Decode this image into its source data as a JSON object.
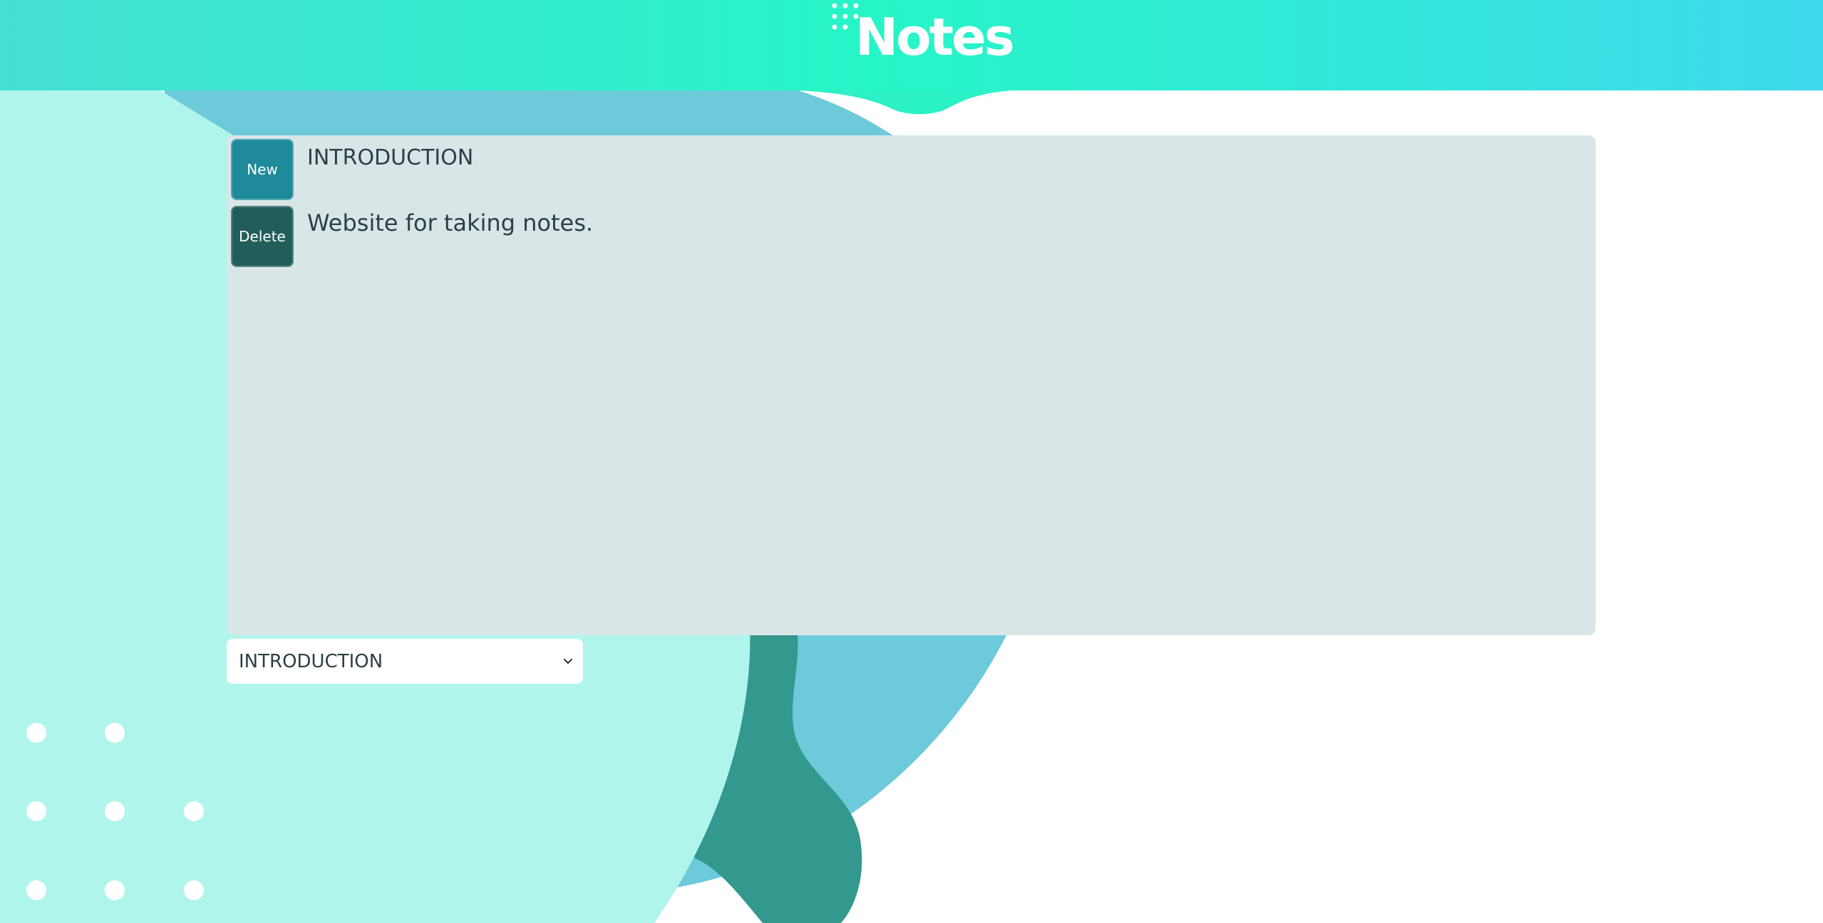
{
  "app": {
    "title": "Notes"
  },
  "colors": {
    "header_gradient": [
      "#45dfd4",
      "#26f5c7",
      "#3ed9ec"
    ],
    "panel_background": "#d9e6e8",
    "new_button": "#1e8a9a",
    "delete_button": "#215e5a",
    "text": "#2e3f45",
    "blob_mint": "#b0f5eb",
    "blob_blue": "#6ccadb",
    "blob_teal": "#33988e"
  },
  "toolbar": {
    "new_label": "New",
    "delete_label": "Delete"
  },
  "note": {
    "title": "INTRODUCTION",
    "body": "Website for taking notes."
  },
  "note_selector": {
    "selected": "INTRODUCTION",
    "options": [
      "INTRODUCTION"
    ]
  },
  "icons": {
    "brand_dots": "dots-grid-icon",
    "select_chevron": "chevron-down-icon",
    "background_dots": "dots-grid-icon"
  }
}
